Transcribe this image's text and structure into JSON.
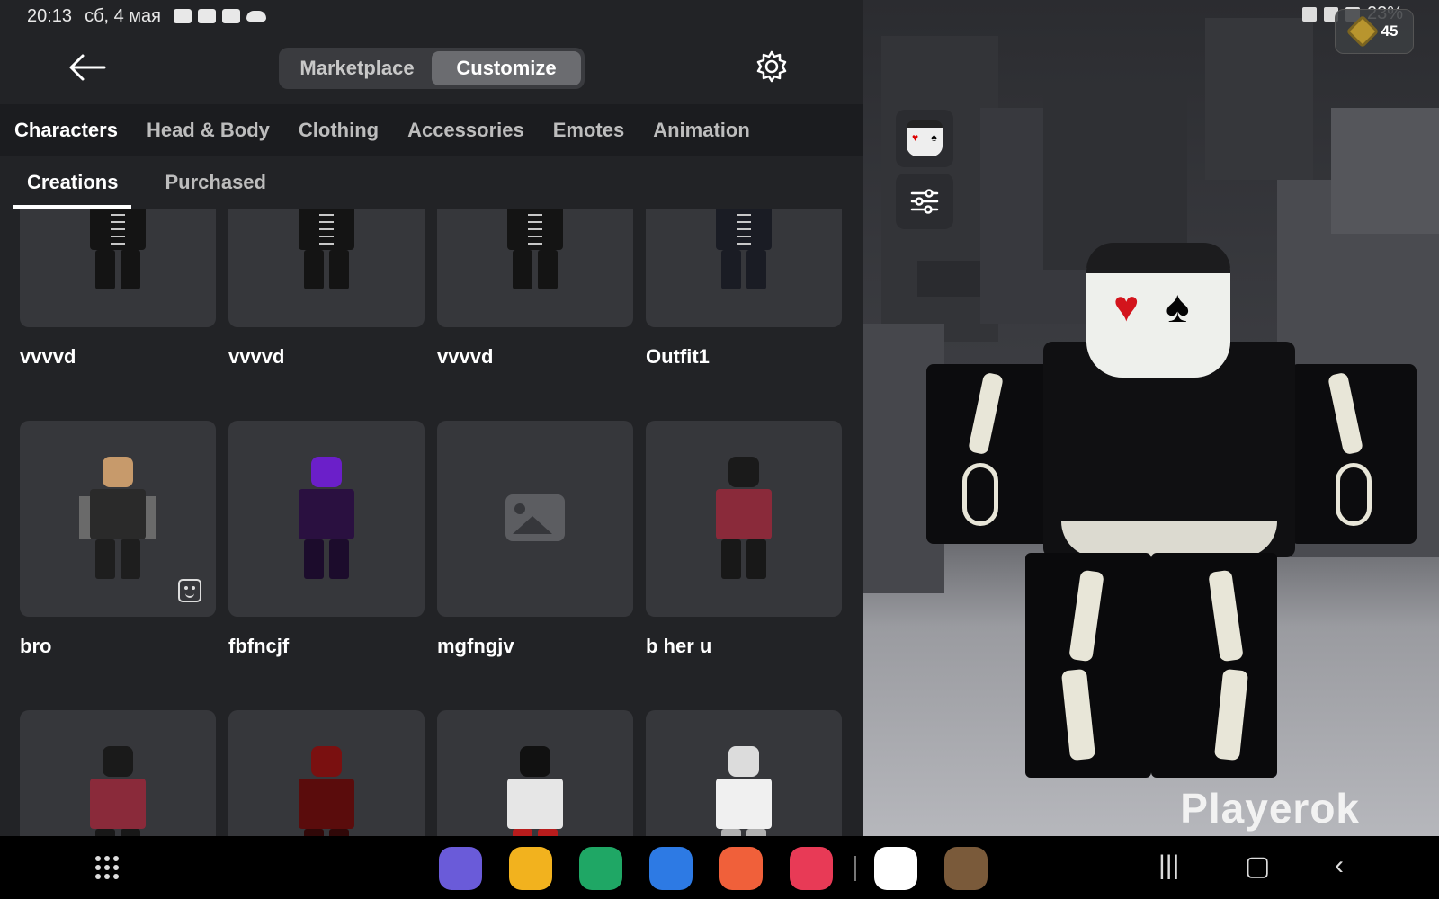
{
  "status_bar": {
    "time": "20:13",
    "date": "сб, 4 мая",
    "battery": "23%"
  },
  "currency": {
    "count": "45",
    "icon": "robux-icon"
  },
  "header": {
    "back_icon": "arrow-left-icon",
    "tabs": [
      {
        "label": "Marketplace",
        "active": false
      },
      {
        "label": "Customize",
        "active": true
      }
    ],
    "settings_icon": "gear-icon"
  },
  "categories": [
    {
      "label": "Characters",
      "active": true
    },
    {
      "label": "Head & Body",
      "active": false
    },
    {
      "label": "Clothing",
      "active": false
    },
    {
      "label": "Accessories",
      "active": false
    },
    {
      "label": "Emotes",
      "active": false
    },
    {
      "label": "Animation",
      "active": false
    }
  ],
  "sub_tabs": [
    {
      "label": "Creations",
      "active": true
    },
    {
      "label": "Purchased",
      "active": false
    }
  ],
  "outfits": [
    {
      "name": "vvvvd",
      "style": "skeleton"
    },
    {
      "name": "vvvvd",
      "style": "skeleton"
    },
    {
      "name": "vvvvd",
      "style": "skeleton"
    },
    {
      "name": "Outfit1",
      "style": "skeleton-dark"
    },
    {
      "name": "bro",
      "style": "suit",
      "badge": "emote-icon"
    },
    {
      "name": "fbfncjf",
      "style": "purple-demon"
    },
    {
      "name": "mgfngjv",
      "style": "placeholder"
    },
    {
      "name": "b her u",
      "style": "tophat-red"
    },
    {
      "name": "",
      "style": "tophat-red"
    },
    {
      "name": "",
      "style": "red-wings"
    },
    {
      "name": "",
      "style": "white-red"
    },
    {
      "name": "",
      "style": "white-hair"
    }
  ],
  "viewport": {
    "watermark": "Playerok"
  },
  "colors": {
    "panel_bg": "#222326",
    "card_bg": "#36373b",
    "tab_bar_bg": "#1b1c1f",
    "active_segment": "#6b6c70"
  }
}
